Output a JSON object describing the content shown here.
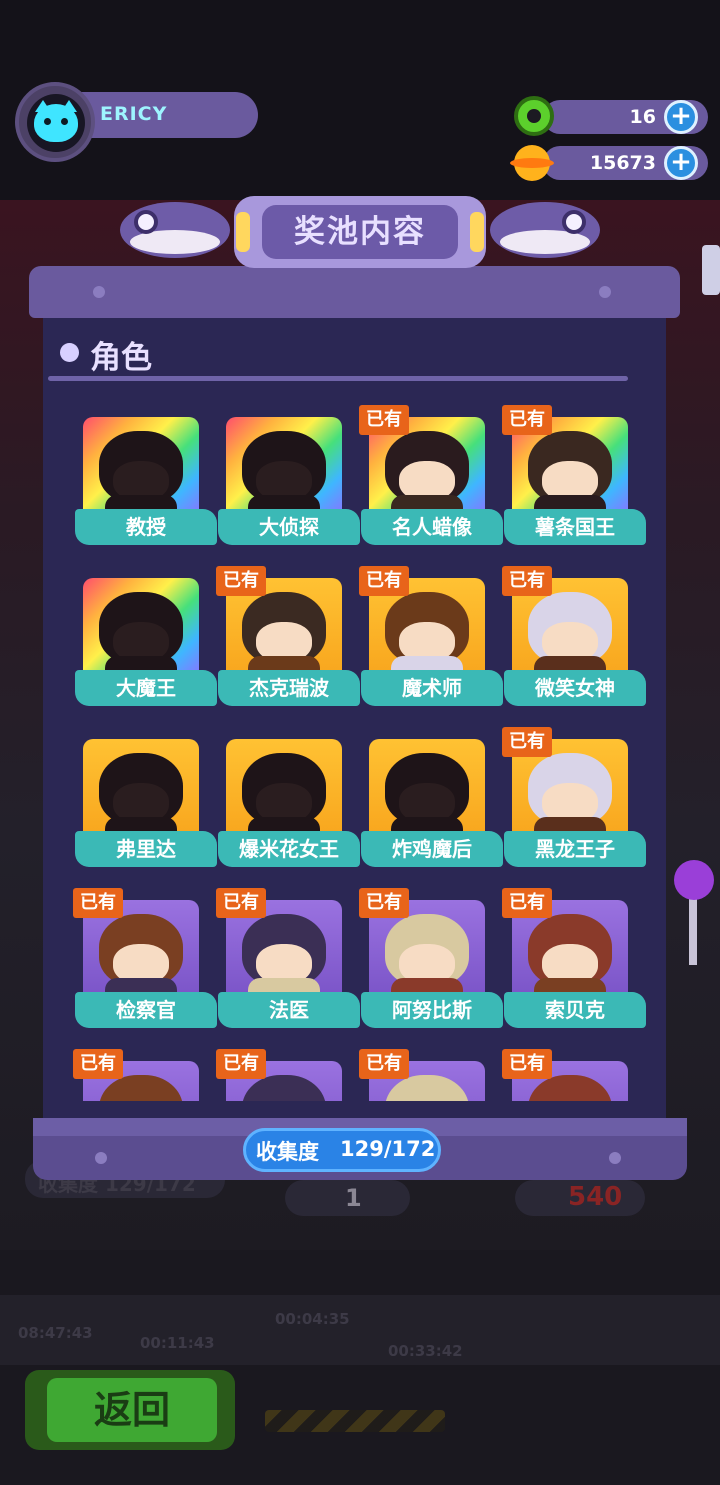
{
  "profile": {
    "username": "ERICY",
    "avatar_icon": "cyan-cat-icon"
  },
  "currencies": [
    {
      "icon": "green-donut-icon",
      "value": "16",
      "plus": "+"
    },
    {
      "icon": "planet-coin-icon",
      "value": "15673",
      "plus": "+"
    }
  ],
  "panel": {
    "title": "奖池内容",
    "section_title": "角色",
    "collection_label": "收集度",
    "collection_value": "129/172"
  },
  "characters": [
    {
      "name": "教授",
      "rarity": "rainbow",
      "owned": false,
      "owned_label": ""
    },
    {
      "name": "大侦探",
      "rarity": "rainbow",
      "owned": false,
      "owned_label": ""
    },
    {
      "name": "名人蜡像",
      "rarity": "rainbow",
      "owned": true,
      "owned_label": "已有"
    },
    {
      "name": "薯条国王",
      "rarity": "rainbow",
      "owned": true,
      "owned_label": "已有"
    },
    {
      "name": "大魔王",
      "rarity": "rainbow",
      "owned": false,
      "owned_label": ""
    },
    {
      "name": "杰克瑞波",
      "rarity": "gold",
      "owned": true,
      "owned_label": "已有"
    },
    {
      "name": "魔术师",
      "rarity": "gold",
      "owned": true,
      "owned_label": "已有"
    },
    {
      "name": "微笑女神",
      "rarity": "gold",
      "owned": true,
      "owned_label": "已有"
    },
    {
      "name": "弗里达",
      "rarity": "gold",
      "owned": false,
      "owned_label": ""
    },
    {
      "name": "爆米花女王",
      "rarity": "gold",
      "owned": false,
      "owned_label": ""
    },
    {
      "name": "炸鸡魔后",
      "rarity": "gold",
      "owned": false,
      "owned_label": ""
    },
    {
      "name": "黑龙王子",
      "rarity": "gold",
      "owned": true,
      "owned_label": "已有"
    },
    {
      "name": "检察官",
      "rarity": "purple",
      "owned": true,
      "owned_label": "已有"
    },
    {
      "name": "法医",
      "rarity": "purple",
      "owned": true,
      "owned_label": "已有"
    },
    {
      "name": "阿努比斯",
      "rarity": "purple",
      "owned": true,
      "owned_label": "已有"
    },
    {
      "name": "索贝克",
      "rarity": "purple",
      "owned": true,
      "owned_label": "已有"
    },
    {
      "name": "",
      "rarity": "purple",
      "owned": true,
      "owned_label": "已有"
    },
    {
      "name": "",
      "rarity": "purple",
      "owned": true,
      "owned_label": "已有"
    },
    {
      "name": "",
      "rarity": "purple",
      "owned": true,
      "owned_label": "已有"
    },
    {
      "name": "",
      "rarity": "purple",
      "owned": true,
      "owned_label": "已有"
    }
  ],
  "background": {
    "collection_ghost": "收集度 129/172",
    "counter_left": "1",
    "counter_right": "540",
    "timers": [
      "08:47:43",
      "00:11:43",
      "00:04:35",
      "00:33:42"
    ]
  },
  "back_button": {
    "label": "返回"
  },
  "colors": {
    "panel": "#2b2754",
    "panel_frame": "#6a5a9e",
    "label_teal": "#3bb9b6",
    "owned_orange": "#e8641a",
    "collect_blue": "#2a83e6",
    "back_green": "#3fa833"
  }
}
